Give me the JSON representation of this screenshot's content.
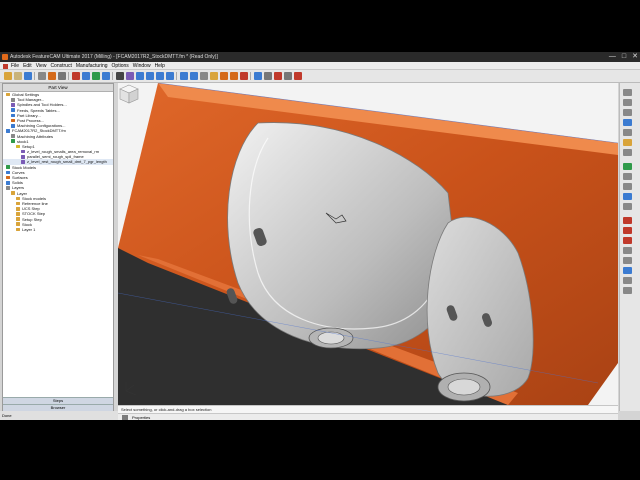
{
  "window": {
    "title": "Autodesk FeatureCAM Ultimate 2017 (Milling) - [FCAM2017R2_StockDMTT.fm * (Read Only)]",
    "buttons": [
      "—",
      "□",
      "✕"
    ]
  },
  "menu": [
    "File",
    "Edit",
    "View",
    "Construct",
    "Manufacturing",
    "Options",
    "Window",
    "Help"
  ],
  "part_view": {
    "title": "Part View",
    "tree": [
      {
        "label": "Global Settings",
        "indent": 0,
        "icon": "folder",
        "color": "#d9a43a"
      },
      {
        "label": "Tool Manager...",
        "indent": 1,
        "icon": "tool",
        "color": "#888888"
      },
      {
        "label": "Spindles and Tool Holders...",
        "indent": 1,
        "icon": "tool",
        "color": "#7a5bb5"
      },
      {
        "label": "Feeds, Speeds Tables...",
        "indent": 1,
        "icon": "table",
        "color": "#3b7bd1"
      },
      {
        "label": "Part Library...",
        "indent": 1,
        "icon": "book",
        "color": "#3b7bd1"
      },
      {
        "label": "Post Process...",
        "indent": 1,
        "icon": "post",
        "color": "#d46a1a"
      },
      {
        "label": "Machining Configurations...",
        "indent": 1,
        "icon": "config",
        "color": "#3b7bd1"
      },
      {
        "label": "FCAM2017R2_StockDMTT.fm",
        "indent": 0,
        "icon": "doc",
        "color": "#3b7bd1"
      },
      {
        "label": "Machining Attributes",
        "indent": 1,
        "icon": "attrib",
        "color": "#888888"
      },
      {
        "label": "stock1",
        "indent": 1,
        "icon": "stock",
        "color": "#2f9a4a"
      },
      {
        "label": "Setup1",
        "indent": 2,
        "icon": "setup",
        "color": "#d4b92a"
      },
      {
        "label": "z_level_rough_smalls_area_removal_rm",
        "indent": 3,
        "icon": "op",
        "color": "#7a5bb5"
      },
      {
        "label": "parallel_semi_rough_spil_frame",
        "indent": 3,
        "icon": "op",
        "color": "#7a5bb5"
      },
      {
        "label": "z_level_rest_rough_small_dmt_7_pgr_length",
        "indent": 3,
        "icon": "op",
        "color": "#7a5bb5",
        "selected": true
      },
      {
        "label": "Stock Models",
        "indent": 0,
        "icon": "stock",
        "color": "#2f9a4a"
      },
      {
        "label": "Curves",
        "indent": 0,
        "icon": "curve",
        "color": "#3b7bd1"
      },
      {
        "label": "Surfaces",
        "indent": 0,
        "icon": "surface",
        "color": "#d46a1a"
      },
      {
        "label": "Solids",
        "indent": 0,
        "icon": "solid",
        "color": "#3b7bd1"
      },
      {
        "label": "Layers",
        "indent": 0,
        "icon": "layers",
        "color": "#888888"
      },
      {
        "label": "Layer",
        "indent": 1,
        "icon": "layer",
        "color": "#d9a43a"
      },
      {
        "label": "Stock models",
        "indent": 2,
        "icon": "layer",
        "color": "#d9a43a"
      },
      {
        "label": "Reference line",
        "indent": 2,
        "icon": "layer",
        "color": "#d9a43a"
      },
      {
        "label": "UCS Step",
        "indent": 2,
        "icon": "layer",
        "color": "#d9a43a"
      },
      {
        "label": "STOCK Step",
        "indent": 2,
        "icon": "layer",
        "color": "#d9a43a"
      },
      {
        "label": "Setup Step",
        "indent": 2,
        "icon": "layer",
        "color": "#d9a43a"
      },
      {
        "label": "Stock",
        "indent": 2,
        "icon": "layer",
        "color": "#d9a43a"
      },
      {
        "label": "Layer 1",
        "indent": 2,
        "icon": "layer",
        "color": "#d9a43a"
      }
    ],
    "footer_steps": "Steps",
    "footer_browser": "Browser"
  },
  "status": {
    "prompt": "Select something, or click-and-drag a box selection",
    "properties": "Properties",
    "app_status": "Done"
  },
  "colors": {
    "accent_orange": "#d65a1f",
    "part_gray": "#bdbdbd",
    "viewport_bg": "#f3f3f3"
  }
}
